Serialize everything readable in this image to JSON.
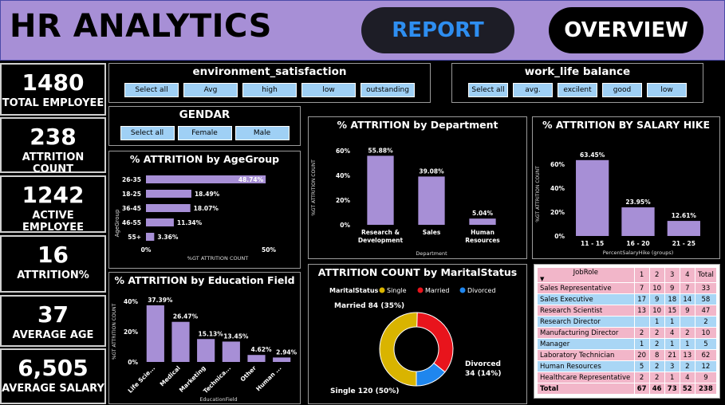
{
  "header": {
    "title": "HR ANALYTICS",
    "report_label": "REPORT",
    "overview_label": "OVERVIEW"
  },
  "kpis": [
    {
      "value": "1480",
      "label": "TOTAL EMPLOYEE"
    },
    {
      "value": "238",
      "label": "ATTRITION COUNT"
    },
    {
      "value": "1242",
      "label": "ACTIVE EMPLOYEE"
    },
    {
      "value": "16",
      "label": "ATTRITION%"
    },
    {
      "value": "37",
      "label": "AVERAGE AGE"
    },
    {
      "value": "6,505",
      "label": "AVERAGE SALARY"
    }
  ],
  "slicers": {
    "env": {
      "title": "environment_satisfaction",
      "options": [
        "Select all",
        "Avg",
        "high",
        "low",
        "outstanding"
      ]
    },
    "wlb": {
      "title": "work_life balance",
      "options": [
        "Select all",
        "avg.",
        "excilent",
        "good",
        "low"
      ]
    },
    "gender": {
      "title": "GENDAR",
      "options": [
        "Select all",
        "Female",
        "Male"
      ]
    }
  },
  "colors": {
    "bar": "#a78fd6",
    "single": "#d9b400",
    "married": "#e8141c",
    "divorced": "#1f86ee",
    "header_bg": "#a78fd6",
    "report_text": "#2e8ef0"
  },
  "chart_data": [
    {
      "id": "age",
      "type": "bar",
      "orientation": "horizontal",
      "title": "% ATTRITION by AgeGroup",
      "xlabel": "%GT ATTRITION COUNT",
      "ylabel": "AgeGroup",
      "categories": [
        "26-35",
        "18-25",
        "36-45",
        "46-55",
        "55+"
      ],
      "values": [
        48.74,
        18.49,
        18.07,
        11.34,
        3.36
      ],
      "data_labels": [
        "48.74%",
        "18.49%",
        "18.07%",
        "11.34%",
        "3.36%"
      ],
      "xlim": [
        0,
        50
      ],
      "ticks": [
        "0%",
        "50%"
      ]
    },
    {
      "id": "dept",
      "type": "bar",
      "title": "% ATTRITION by Department",
      "xlabel": "Department",
      "ylabel": "%GT ATTRITION COUNT",
      "categories": [
        "Research & Development",
        "Sales",
        "Human Resources"
      ],
      "category_lines": [
        [
          "Research &",
          "Development"
        ],
        [
          "Sales"
        ],
        [
          "Human",
          "Resources"
        ]
      ],
      "values": [
        55.88,
        39.08,
        5.04
      ],
      "data_labels": [
        "55.88%",
        "39.08%",
        "5.04%"
      ],
      "ylim": [
        0,
        60
      ],
      "ticks": [
        "0%",
        "20%",
        "40%",
        "60%"
      ]
    },
    {
      "id": "hike",
      "type": "bar",
      "title": "% ATTRITION BY SALARY HIKE",
      "xlabel": "PercentSalaryHike (groups)",
      "ylabel": "%GT ATTRITION COUNT",
      "categories": [
        "11 - 15",
        "16 - 20",
        "21 - 25"
      ],
      "values": [
        63.45,
        23.95,
        12.61
      ],
      "data_labels": [
        "63.45%",
        "23.95%",
        "12.61%"
      ],
      "ylim": [
        0,
        70
      ],
      "ticks": [
        "0%",
        "20%",
        "40%",
        "60%"
      ]
    },
    {
      "id": "edu",
      "type": "bar",
      "title": "% ATTRITION by Education Field",
      "xlabel": "EducationField",
      "ylabel": "%GT ATTRITION COUNT",
      "categories": [
        "Life Scie...",
        "Medical",
        "Marketing",
        "Technica...",
        "Other",
        "Human ..."
      ],
      "values": [
        37.39,
        26.47,
        15.13,
        13.45,
        4.62,
        2.94
      ],
      "data_labels": [
        "37.39%",
        "26.47%",
        "15.13%",
        "13.45%",
        "4.62%",
        "2.94%"
      ],
      "ylim": [
        0,
        40
      ],
      "ticks": [
        "0%",
        "20%",
        "40%"
      ]
    },
    {
      "id": "marital",
      "type": "pie",
      "donut": true,
      "title": "ATTRITION COUNT by MaritalStatus",
      "legend_title": "MaritalStatus",
      "slices": [
        {
          "name": "Single",
          "value": 120,
          "label": "Single 120 (50%)"
        },
        {
          "name": "Married",
          "value": 84,
          "label": "Married 84 (35%)"
        },
        {
          "name": "Divorced",
          "value": 34,
          "label_lines": [
            "Divorced",
            "34 (14%)"
          ]
        }
      ]
    },
    {
      "id": "jobrole",
      "type": "table",
      "columns": [
        "JobRole",
        "1",
        "2",
        "3",
        "4",
        "Total"
      ],
      "rows": [
        [
          "Sales Representative",
          "7",
          "10",
          "9",
          "7",
          "33"
        ],
        [
          "Sales Executive",
          "17",
          "9",
          "18",
          "14",
          "58"
        ],
        [
          "Research Scientist",
          "13",
          "10",
          "15",
          "9",
          "47"
        ],
        [
          "Research Director",
          "",
          "1",
          "1",
          "",
          "2"
        ],
        [
          "Manufacturing Director",
          "2",
          "2",
          "4",
          "2",
          "10"
        ],
        [
          "Manager",
          "1",
          "2",
          "1",
          "1",
          "5"
        ],
        [
          "Laboratory Technician",
          "20",
          "8",
          "21",
          "13",
          "62"
        ],
        [
          "Human Resources",
          "5",
          "2",
          "3",
          "2",
          "12"
        ],
        [
          "Healthcare Representative",
          "2",
          "2",
          "1",
          "4",
          "9"
        ]
      ],
      "total": [
        "Total",
        "67",
        "46",
        "73",
        "52",
        "238"
      ]
    }
  ]
}
